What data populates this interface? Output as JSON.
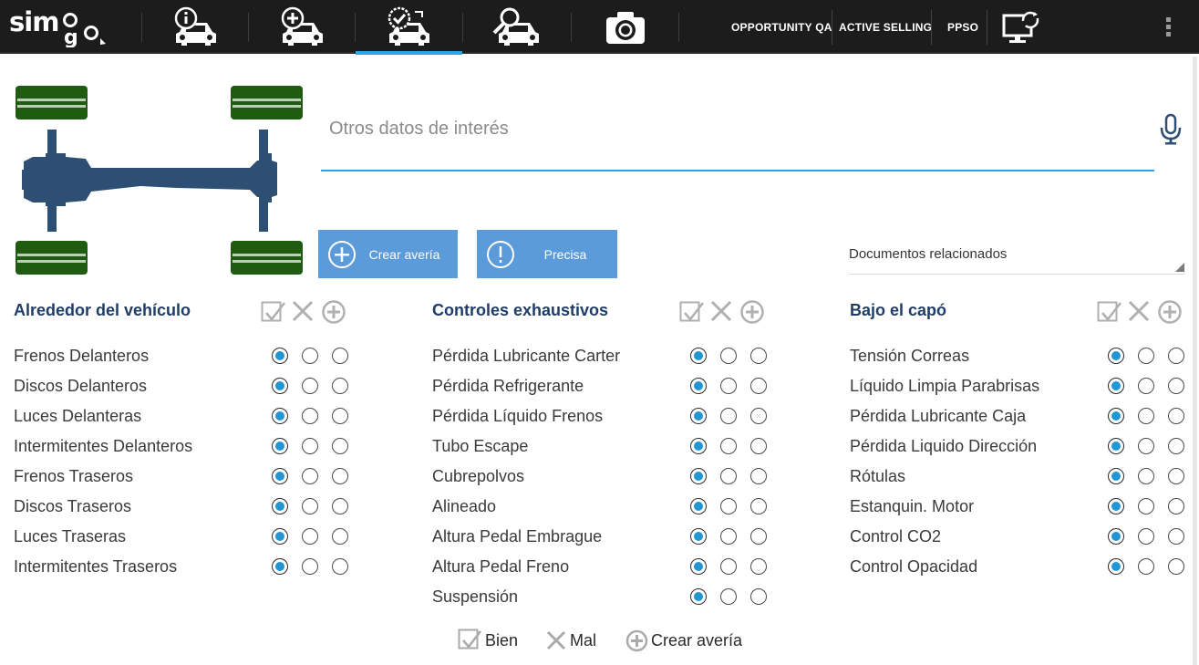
{
  "app": {
    "logo_text": "simago"
  },
  "topbar": {
    "nav": [
      {
        "name": "vehicle-info",
        "icon": "car-info-icon"
      },
      {
        "name": "vehicle-add",
        "icon": "car-add-icon"
      },
      {
        "name": "vehicle-check",
        "icon": "car-check-icon",
        "active": true
      },
      {
        "name": "vehicle-search",
        "icon": "car-search-icon"
      },
      {
        "name": "camera",
        "icon": "camera-icon"
      }
    ],
    "links": [
      "OPPORTUNITY QA",
      "ACTIVE SELLING",
      "PPSO"
    ],
    "sync_icon": "monitor-sync-icon",
    "menu_icon": "kebab-menu-icon",
    "active_color": "#29a8e0"
  },
  "notes": {
    "placeholder": "Otros datos de interés",
    "value": ""
  },
  "actions": {
    "create_fault": "Crear avería",
    "precise": "Precisa",
    "button_color": "#5b9bd9"
  },
  "documents": {
    "selected": "Documentos relacionados"
  },
  "sections": [
    {
      "title": "Alrededor del vehículo",
      "items": [
        {
          "label": "Frenos Delanteros",
          "state": "bien"
        },
        {
          "label": "Discos Delanteros",
          "state": "bien"
        },
        {
          "label": "Luces Delanteras",
          "state": "bien"
        },
        {
          "label": "Intermitentes Delanteros",
          "state": "bien"
        },
        {
          "label": "Frenos Traseros",
          "state": "bien"
        },
        {
          "label": "Discos Traseros",
          "state": "bien"
        },
        {
          "label": "Luces Traseras",
          "state": "bien"
        },
        {
          "label": "Intermitentes Traseros",
          "state": "bien"
        }
      ]
    },
    {
      "title": "Controles exhaustivos",
      "items": [
        {
          "label": "Pérdida Lubricante Carter",
          "state": "bien"
        },
        {
          "label": "Pérdida Refrigerante",
          "state": "bien"
        },
        {
          "label": "Pérdida Líquido Frenos",
          "state": "bien"
        },
        {
          "label": "Tubo Escape",
          "state": "bien"
        },
        {
          "label": "Cubrepolvos",
          "state": "bien"
        },
        {
          "label": "Alineado",
          "state": "bien"
        },
        {
          "label": "Altura Pedal Embrague",
          "state": "bien"
        },
        {
          "label": "Altura Pedal Freno",
          "state": "bien"
        },
        {
          "label": "Suspensión",
          "state": "bien"
        }
      ]
    },
    {
      "title": "Bajo el capó",
      "items": [
        {
          "label": "Tensión Correas",
          "state": "bien"
        },
        {
          "label": "Líquido Limpia Parabrisas",
          "state": "bien"
        },
        {
          "label": "Pérdida Lubricante Caja",
          "state": "bien"
        },
        {
          "label": "Pérdida Liquido Dirección",
          "state": "bien"
        },
        {
          "label": "Rótulas",
          "state": "bien"
        },
        {
          "label": "Estanquin. Motor",
          "state": "bien"
        },
        {
          "label": "Control CO2",
          "state": "bien"
        },
        {
          "label": "Control Opacidad",
          "state": "bien"
        }
      ]
    }
  ],
  "legend": {
    "ok": "Bien",
    "bad": "Mal",
    "fault": "Crear avería"
  },
  "colors": {
    "section_title": "#1f3d66",
    "radio_selected": "#2196d3",
    "tire": "#1f5c12",
    "chassis": "#2d4f73"
  }
}
